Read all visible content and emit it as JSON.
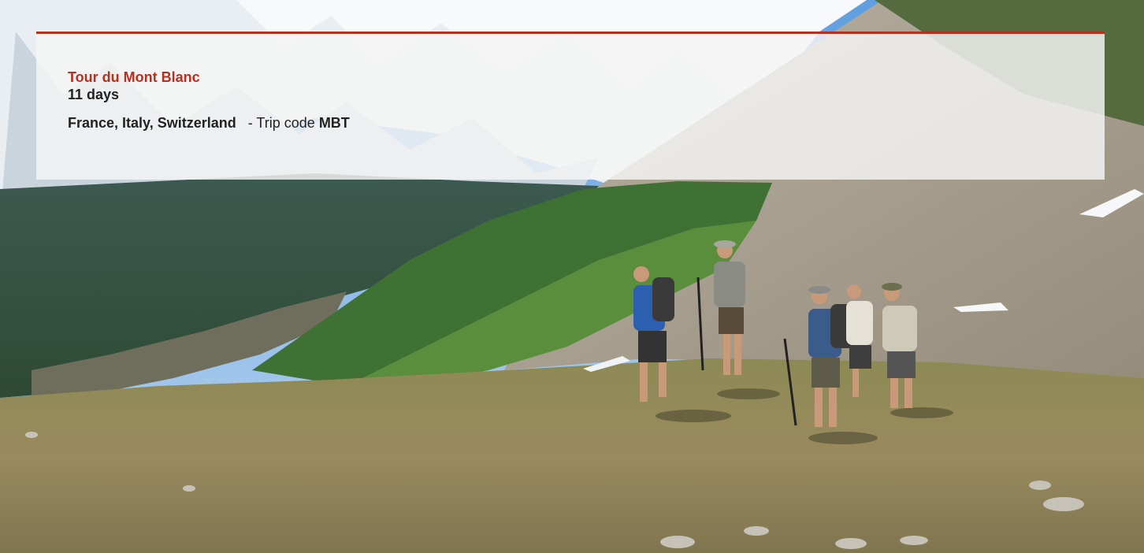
{
  "trip": {
    "title": "Tour du Mont Blanc",
    "duration": "11 days",
    "countries": "France, Italy, Switzerland",
    "code_label": "- Trip code",
    "code": "MBT"
  },
  "colors": {
    "accent": "#b5301f",
    "text": "#222222",
    "card_bg": "#f4f4f4"
  },
  "hero_image": {
    "subject": "hikers-on-alpine-meadow"
  }
}
